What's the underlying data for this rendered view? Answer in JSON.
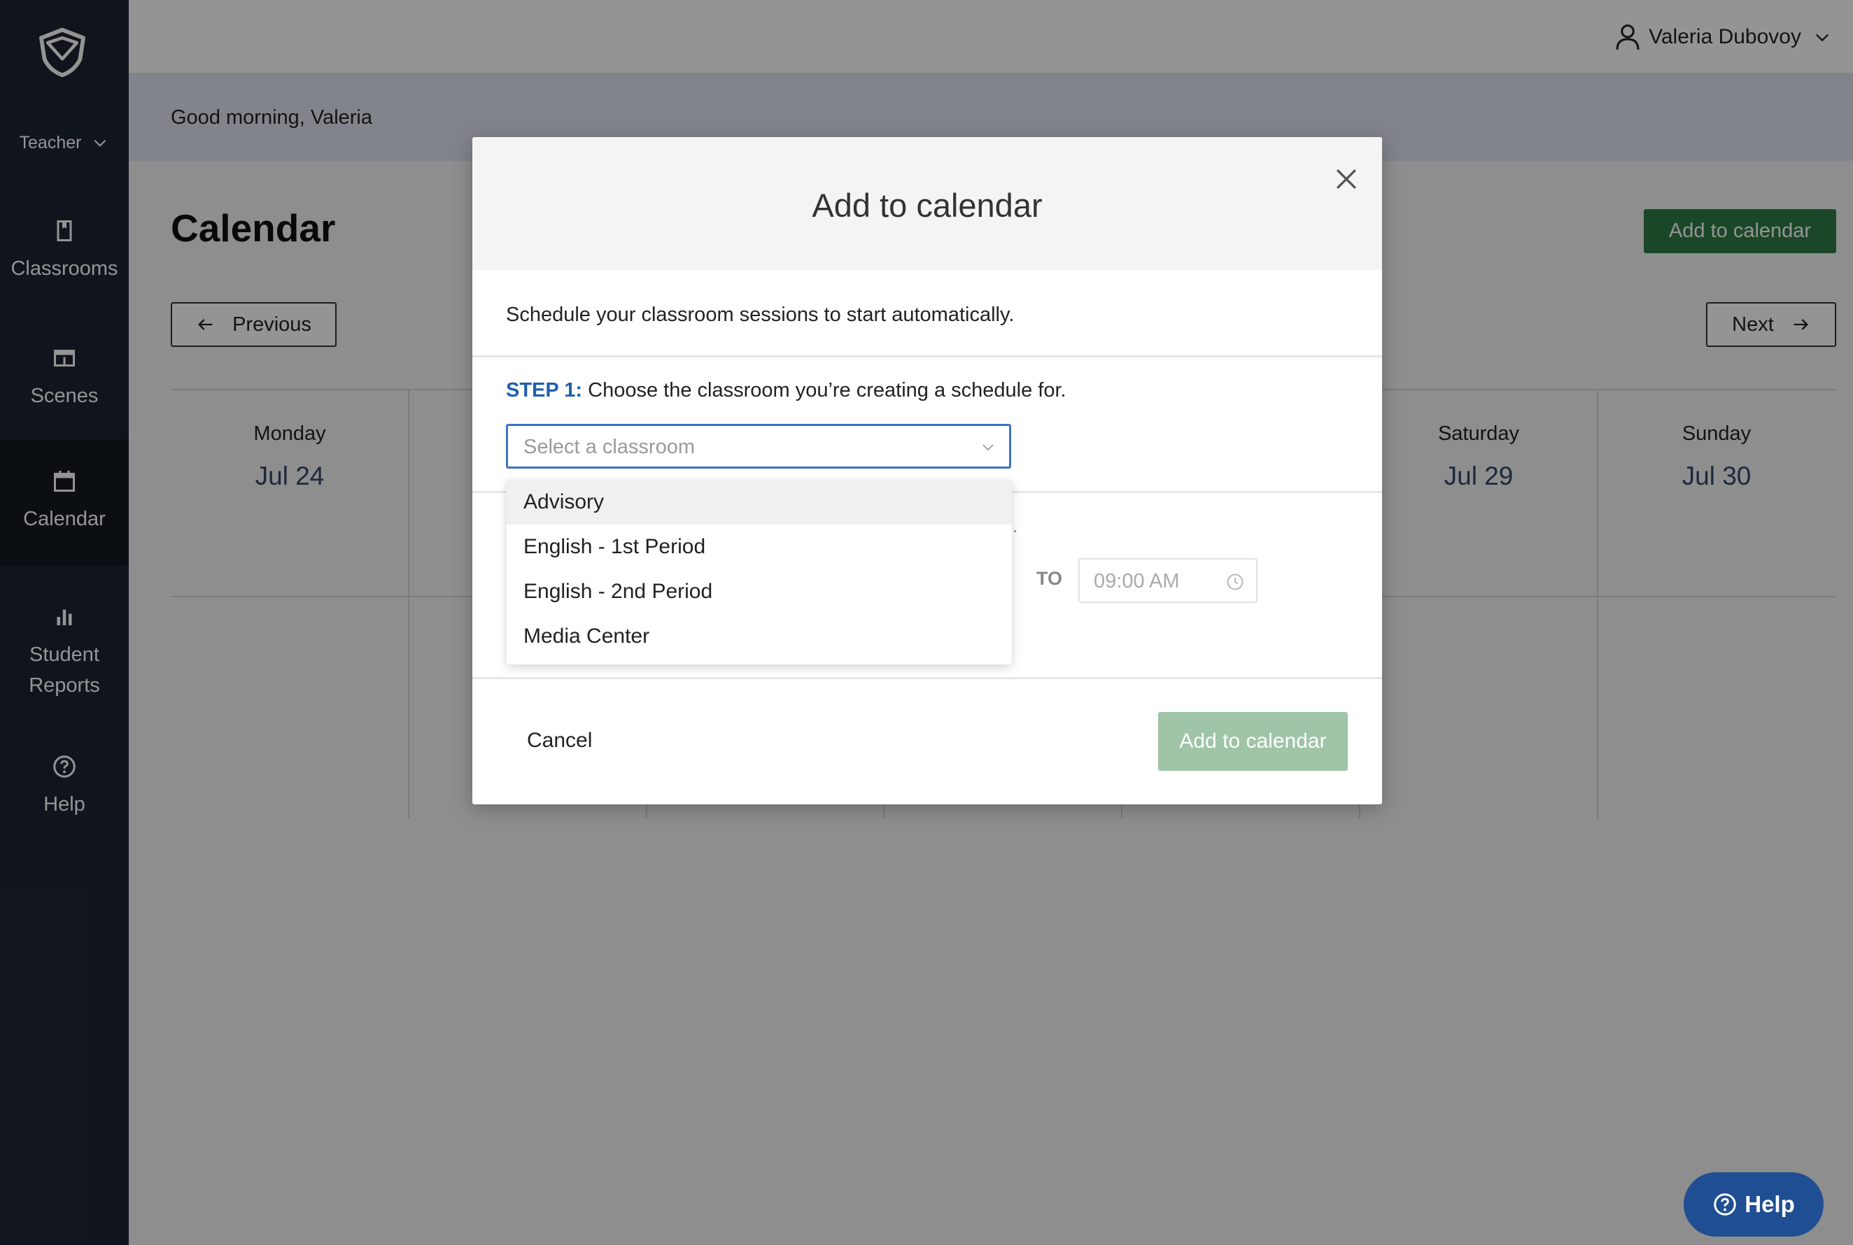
{
  "sidebar": {
    "role": "Teacher",
    "items": [
      {
        "label": "Classrooms",
        "icon": "book-icon"
      },
      {
        "label": "Scenes",
        "icon": "scene-icon"
      },
      {
        "label": "Calendar",
        "icon": "calendar-icon",
        "active": true
      },
      {
        "label_line1": "Student",
        "label_line2": "Reports",
        "icon": "bar-chart-icon"
      },
      {
        "label": "Help",
        "icon": "help-circle-icon"
      }
    ]
  },
  "topbar": {
    "user_name": "Valeria Dubovoy"
  },
  "greeting": "Good morning, Valeria",
  "page": {
    "title": "Calendar",
    "add_button": "Add to calendar",
    "previous": "Previous",
    "next": "Next",
    "days": [
      {
        "name": "Monday",
        "date": "Jul 24"
      },
      {
        "name": "Saturday",
        "date": "Jul 29"
      },
      {
        "name": "Sunday",
        "date": "Jul 30"
      }
    ],
    "help_fab": "Help"
  },
  "modal": {
    "title": "Add to calendar",
    "intro": "Schedule your classroom sessions to start automatically.",
    "step1_label": "STEP 1:",
    "step1_text": " Choose the classroom you’re creating a schedule for.",
    "select_placeholder": "Select a classroom",
    "hint_tail": "s.",
    "to_label": "TO",
    "to_time": "09:00 AM",
    "cancel": "Cancel",
    "submit": "Add to calendar"
  },
  "dropdown": {
    "options": [
      "Advisory",
      "English - 1st Period",
      "English - 2nd Period",
      "Media Center"
    ],
    "highlighted_index": 0
  },
  "colors": {
    "sidebar_bg": "#1c2533",
    "primary_green": "#2f7a47",
    "disabled_green": "#9fc4a7",
    "step_blue": "#1f5fae",
    "help_blue": "#1f4e93"
  }
}
